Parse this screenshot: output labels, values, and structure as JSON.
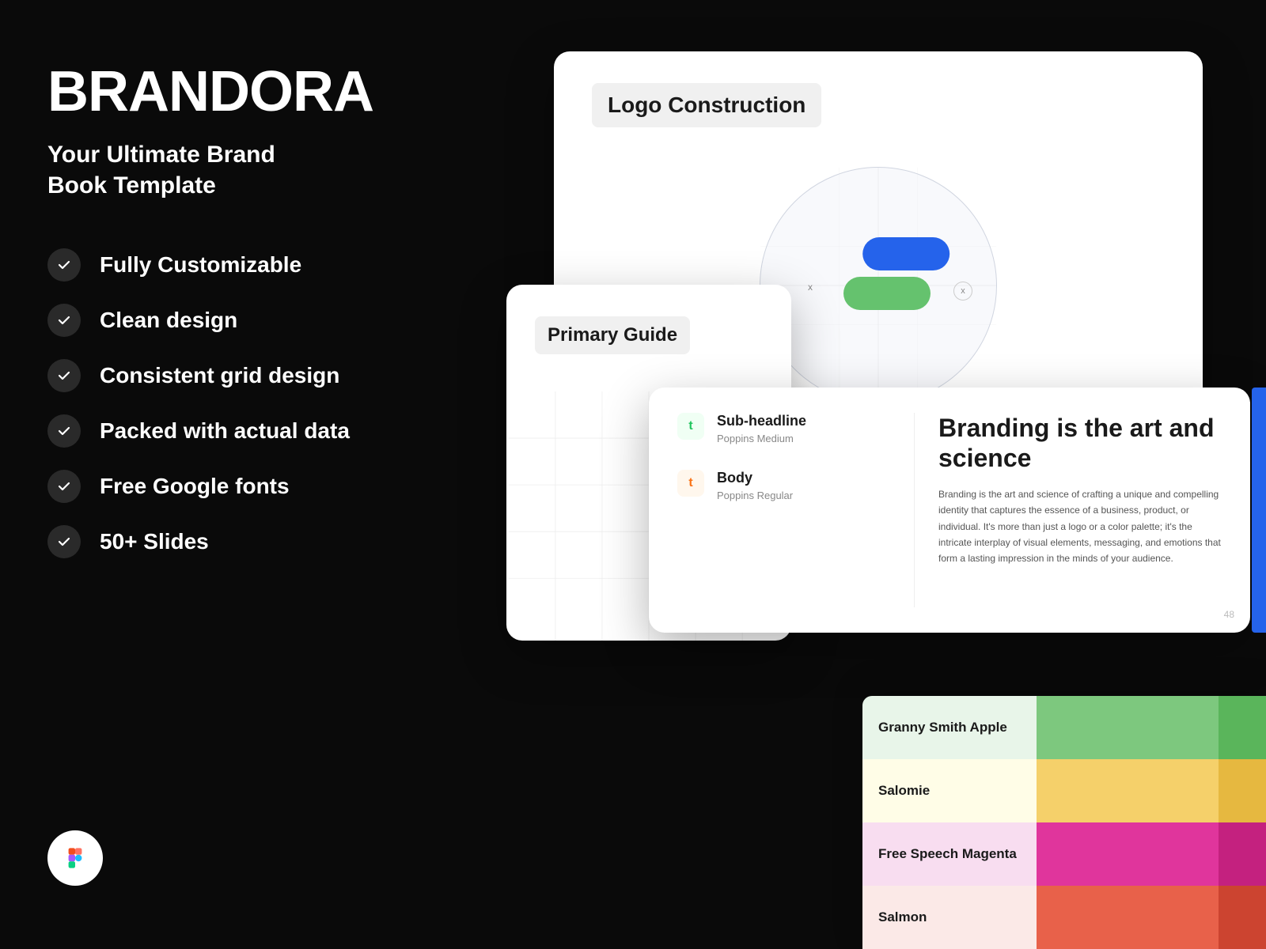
{
  "brand": {
    "name": "BRANDORA",
    "subtitle": "Your Ultimate Brand\nBook Template",
    "figma_label": "Figma"
  },
  "features": [
    {
      "id": "customizable",
      "label": "Fully Customizable"
    },
    {
      "id": "clean-design",
      "label": "Clean design"
    },
    {
      "id": "grid-design",
      "label": "Consistent grid design"
    },
    {
      "id": "actual-data",
      "label": "Packed with actual data"
    },
    {
      "id": "google-fonts",
      "label": "Free Google fonts"
    },
    {
      "id": "slides",
      "label": "50+ Slides"
    }
  ],
  "logo_card": {
    "title": "Logo Construction",
    "x_left": "x",
    "x_right": "x"
  },
  "primary_card": {
    "title": "Primary Guide"
  },
  "typography_card": {
    "items": [
      {
        "label": "Sub-headline",
        "font": "Poppins Medium",
        "badge_color": "green"
      },
      {
        "label": "Body",
        "font": "Poppins Regular",
        "badge_color": "orange"
      }
    ],
    "headline": "Branding is the art and science",
    "body_text": "Branding is the art and science of crafting a unique and compelling identity that captures the essence of a business, product, or individual. It's more than just a logo or a color palette; it's the intricate interplay of visual elements, messaging, and emotions that form a lasting impression in the minds of your audience.",
    "page_number": "48"
  },
  "colors": [
    {
      "name": "Granny Smith Apple",
      "main": "#7dc87e",
      "alt": "#5ab55b",
      "text_color": "#1a1a1a",
      "bg": "#e8f5e9"
    },
    {
      "name": "Salomie",
      "main": "#f5d06a",
      "alt": "#e6b840",
      "text_color": "#1a1a1a",
      "bg": "#fffde7"
    },
    {
      "name": "Free Speech Magenta",
      "main": "#e0359c",
      "alt": "#c4217f",
      "text_color": "#ffffff",
      "bg": "#fce4ec"
    },
    {
      "name": "Salmon",
      "main": "#e8614a",
      "alt": "#cc4430",
      "text_color": "#ffffff",
      "bg": "#fbe9e7"
    }
  ],
  "right_accent": {
    "blue": "#2563eb",
    "green": "#65c26e"
  }
}
